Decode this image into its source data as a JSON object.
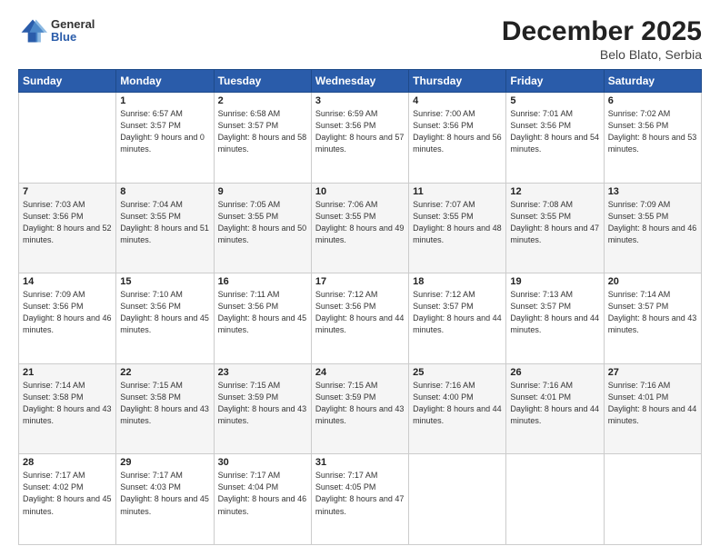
{
  "header": {
    "logo": {
      "general": "General",
      "blue": "Blue"
    },
    "title": "December 2025",
    "subtitle": "Belo Blato, Serbia"
  },
  "weekdays": [
    "Sunday",
    "Monday",
    "Tuesday",
    "Wednesday",
    "Thursday",
    "Friday",
    "Saturday"
  ],
  "weeks": [
    [
      {
        "day": "",
        "sunrise": "",
        "sunset": "",
        "daylight": ""
      },
      {
        "day": "1",
        "sunrise": "Sunrise: 6:57 AM",
        "sunset": "Sunset: 3:57 PM",
        "daylight": "Daylight: 9 hours and 0 minutes."
      },
      {
        "day": "2",
        "sunrise": "Sunrise: 6:58 AM",
        "sunset": "Sunset: 3:57 PM",
        "daylight": "Daylight: 8 hours and 58 minutes."
      },
      {
        "day": "3",
        "sunrise": "Sunrise: 6:59 AM",
        "sunset": "Sunset: 3:56 PM",
        "daylight": "Daylight: 8 hours and 57 minutes."
      },
      {
        "day": "4",
        "sunrise": "Sunrise: 7:00 AM",
        "sunset": "Sunset: 3:56 PM",
        "daylight": "Daylight: 8 hours and 56 minutes."
      },
      {
        "day": "5",
        "sunrise": "Sunrise: 7:01 AM",
        "sunset": "Sunset: 3:56 PM",
        "daylight": "Daylight: 8 hours and 54 minutes."
      },
      {
        "day": "6",
        "sunrise": "Sunrise: 7:02 AM",
        "sunset": "Sunset: 3:56 PM",
        "daylight": "Daylight: 8 hours and 53 minutes."
      }
    ],
    [
      {
        "day": "7",
        "sunrise": "Sunrise: 7:03 AM",
        "sunset": "Sunset: 3:56 PM",
        "daylight": "Daylight: 8 hours and 52 minutes."
      },
      {
        "day": "8",
        "sunrise": "Sunrise: 7:04 AM",
        "sunset": "Sunset: 3:55 PM",
        "daylight": "Daylight: 8 hours and 51 minutes."
      },
      {
        "day": "9",
        "sunrise": "Sunrise: 7:05 AM",
        "sunset": "Sunset: 3:55 PM",
        "daylight": "Daylight: 8 hours and 50 minutes."
      },
      {
        "day": "10",
        "sunrise": "Sunrise: 7:06 AM",
        "sunset": "Sunset: 3:55 PM",
        "daylight": "Daylight: 8 hours and 49 minutes."
      },
      {
        "day": "11",
        "sunrise": "Sunrise: 7:07 AM",
        "sunset": "Sunset: 3:55 PM",
        "daylight": "Daylight: 8 hours and 48 minutes."
      },
      {
        "day": "12",
        "sunrise": "Sunrise: 7:08 AM",
        "sunset": "Sunset: 3:55 PM",
        "daylight": "Daylight: 8 hours and 47 minutes."
      },
      {
        "day": "13",
        "sunrise": "Sunrise: 7:09 AM",
        "sunset": "Sunset: 3:55 PM",
        "daylight": "Daylight: 8 hours and 46 minutes."
      }
    ],
    [
      {
        "day": "14",
        "sunrise": "Sunrise: 7:09 AM",
        "sunset": "Sunset: 3:56 PM",
        "daylight": "Daylight: 8 hours and 46 minutes."
      },
      {
        "day": "15",
        "sunrise": "Sunrise: 7:10 AM",
        "sunset": "Sunset: 3:56 PM",
        "daylight": "Daylight: 8 hours and 45 minutes."
      },
      {
        "day": "16",
        "sunrise": "Sunrise: 7:11 AM",
        "sunset": "Sunset: 3:56 PM",
        "daylight": "Daylight: 8 hours and 45 minutes."
      },
      {
        "day": "17",
        "sunrise": "Sunrise: 7:12 AM",
        "sunset": "Sunset: 3:56 PM",
        "daylight": "Daylight: 8 hours and 44 minutes."
      },
      {
        "day": "18",
        "sunrise": "Sunrise: 7:12 AM",
        "sunset": "Sunset: 3:57 PM",
        "daylight": "Daylight: 8 hours and 44 minutes."
      },
      {
        "day": "19",
        "sunrise": "Sunrise: 7:13 AM",
        "sunset": "Sunset: 3:57 PM",
        "daylight": "Daylight: 8 hours and 44 minutes."
      },
      {
        "day": "20",
        "sunrise": "Sunrise: 7:14 AM",
        "sunset": "Sunset: 3:57 PM",
        "daylight": "Daylight: 8 hours and 43 minutes."
      }
    ],
    [
      {
        "day": "21",
        "sunrise": "Sunrise: 7:14 AM",
        "sunset": "Sunset: 3:58 PM",
        "daylight": "Daylight: 8 hours and 43 minutes."
      },
      {
        "day": "22",
        "sunrise": "Sunrise: 7:15 AM",
        "sunset": "Sunset: 3:58 PM",
        "daylight": "Daylight: 8 hours and 43 minutes."
      },
      {
        "day": "23",
        "sunrise": "Sunrise: 7:15 AM",
        "sunset": "Sunset: 3:59 PM",
        "daylight": "Daylight: 8 hours and 43 minutes."
      },
      {
        "day": "24",
        "sunrise": "Sunrise: 7:15 AM",
        "sunset": "Sunset: 3:59 PM",
        "daylight": "Daylight: 8 hours and 43 minutes."
      },
      {
        "day": "25",
        "sunrise": "Sunrise: 7:16 AM",
        "sunset": "Sunset: 4:00 PM",
        "daylight": "Daylight: 8 hours and 44 minutes."
      },
      {
        "day": "26",
        "sunrise": "Sunrise: 7:16 AM",
        "sunset": "Sunset: 4:01 PM",
        "daylight": "Daylight: 8 hours and 44 minutes."
      },
      {
        "day": "27",
        "sunrise": "Sunrise: 7:16 AM",
        "sunset": "Sunset: 4:01 PM",
        "daylight": "Daylight: 8 hours and 44 minutes."
      }
    ],
    [
      {
        "day": "28",
        "sunrise": "Sunrise: 7:17 AM",
        "sunset": "Sunset: 4:02 PM",
        "daylight": "Daylight: 8 hours and 45 minutes."
      },
      {
        "day": "29",
        "sunrise": "Sunrise: 7:17 AM",
        "sunset": "Sunset: 4:03 PM",
        "daylight": "Daylight: 8 hours and 45 minutes."
      },
      {
        "day": "30",
        "sunrise": "Sunrise: 7:17 AM",
        "sunset": "Sunset: 4:04 PM",
        "daylight": "Daylight: 8 hours and 46 minutes."
      },
      {
        "day": "31",
        "sunrise": "Sunrise: 7:17 AM",
        "sunset": "Sunset: 4:05 PM",
        "daylight": "Daylight: 8 hours and 47 minutes."
      },
      {
        "day": "",
        "sunrise": "",
        "sunset": "",
        "daylight": ""
      },
      {
        "day": "",
        "sunrise": "",
        "sunset": "",
        "daylight": ""
      },
      {
        "day": "",
        "sunrise": "",
        "sunset": "",
        "daylight": ""
      }
    ]
  ]
}
